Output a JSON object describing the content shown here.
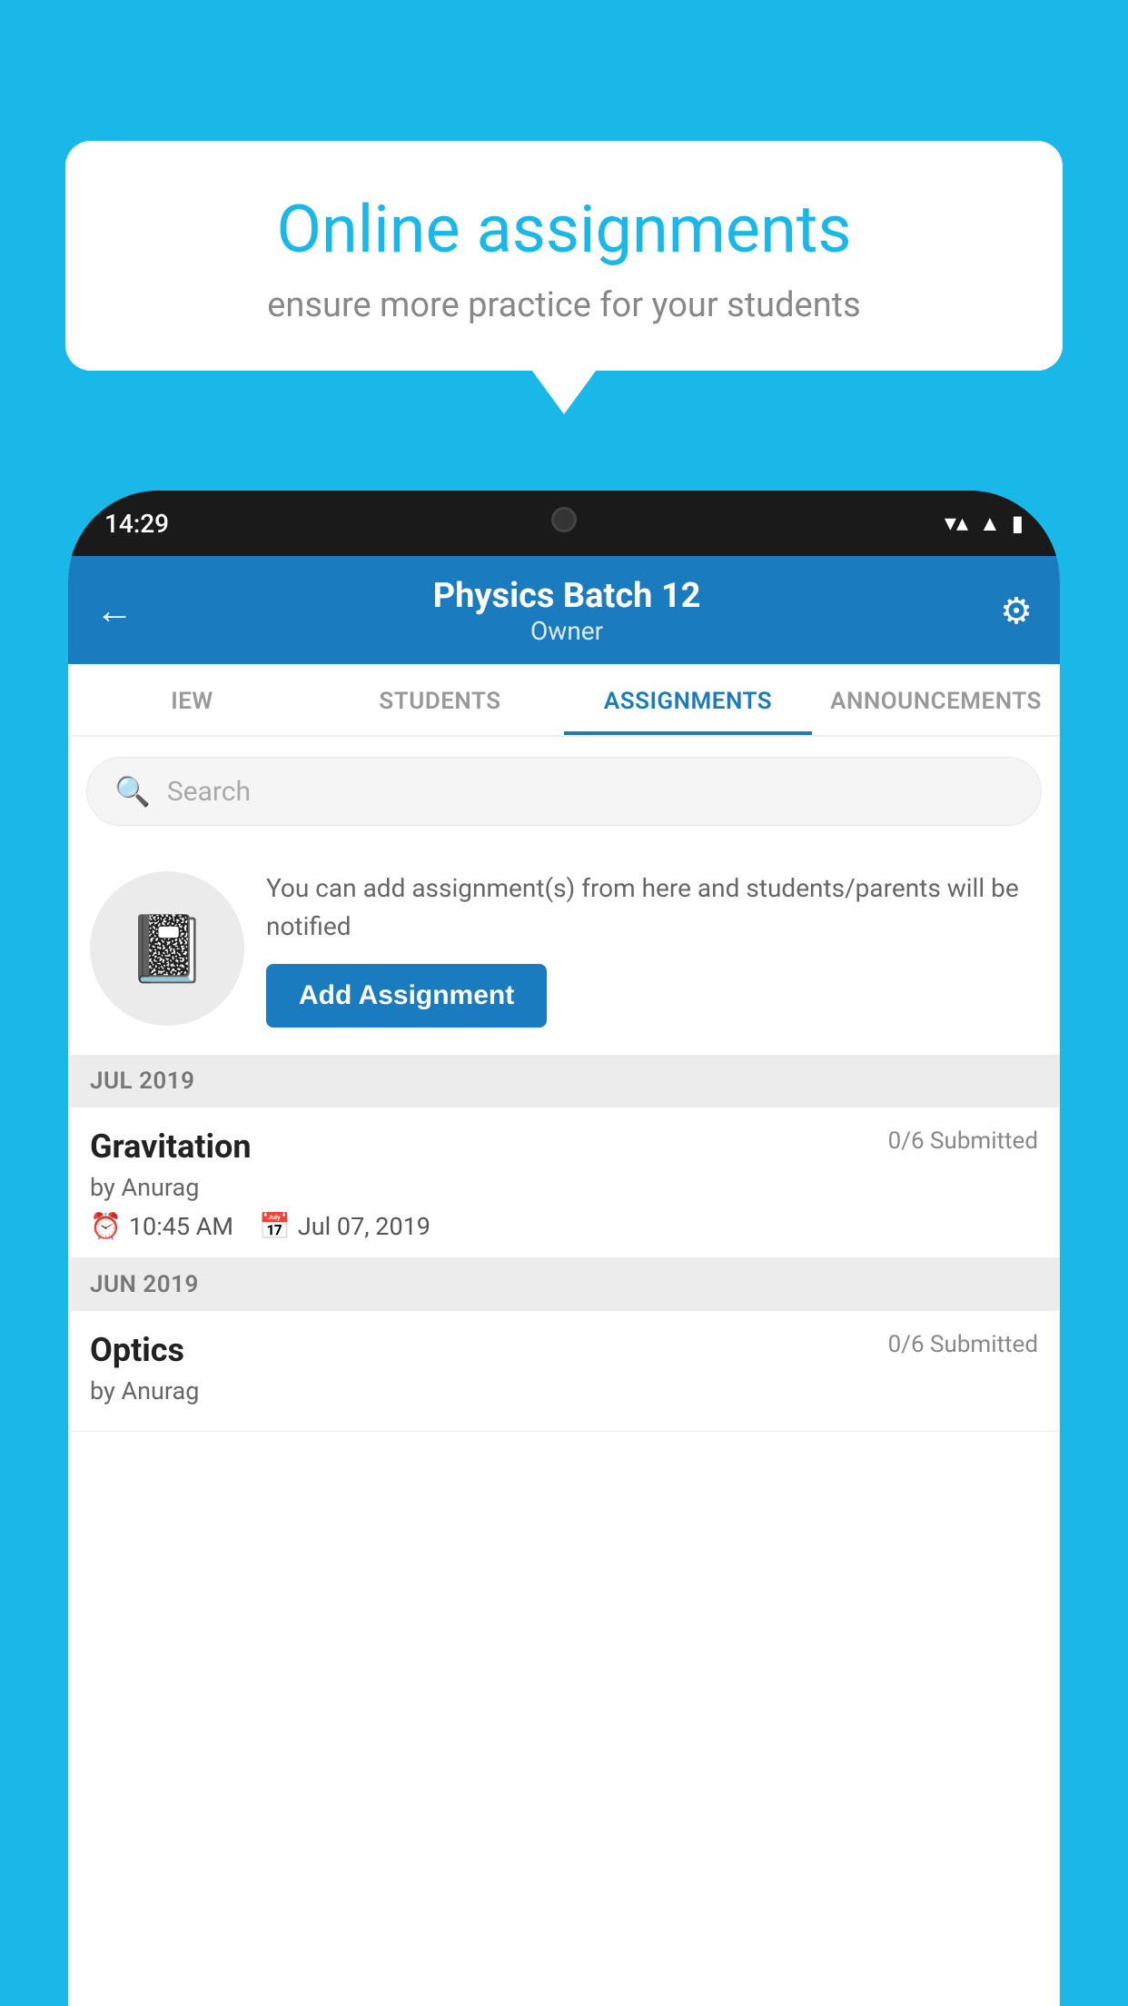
{
  "background_color": "#1ab8e8",
  "tooltip": {
    "title": "Online assignments",
    "subtitle": "ensure more practice for your students"
  },
  "phone": {
    "status_bar": {
      "time": "14:29",
      "wifi_icon": "wifi",
      "signal_icon": "signal",
      "battery_icon": "battery"
    },
    "header": {
      "back_label": "←",
      "title": "Physics Batch 12",
      "subtitle": "Owner",
      "settings_label": "⚙"
    },
    "tabs": [
      {
        "label": "IEW",
        "active": false
      },
      {
        "label": "STUDENTS",
        "active": false
      },
      {
        "label": "ASSIGNMENTS",
        "active": true
      },
      {
        "label": "ANNOUNCEMENTS",
        "active": false
      }
    ],
    "search": {
      "placeholder": "Search"
    },
    "promo": {
      "text": "You can add assignment(s) from here and students/parents will be notified",
      "button_label": "Add Assignment"
    },
    "sections": [
      {
        "label": "JUL 2019",
        "assignments": [
          {
            "name": "Gravitation",
            "submitted": "0/6 Submitted",
            "by": "by Anurag",
            "time": "10:45 AM",
            "date": "Jul 07, 2019"
          }
        ]
      },
      {
        "label": "JUN 2019",
        "assignments": [
          {
            "name": "Optics",
            "submitted": "0/6 Submitted",
            "by": "by Anurag",
            "time": "",
            "date": ""
          }
        ]
      }
    ]
  }
}
